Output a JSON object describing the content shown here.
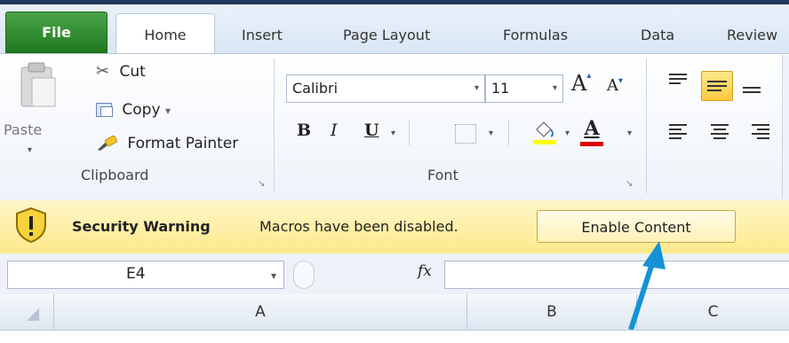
{
  "ribbon_tabs": {
    "file": "File",
    "home": "Home",
    "insert": "Insert",
    "page_layout": "Page Layout",
    "formulas": "Formulas",
    "data": "Data",
    "review": "Review"
  },
  "clipboard": {
    "paste": "Paste",
    "cut": "Cut",
    "copy": "Copy",
    "copy_arrow": "▾",
    "format_painter": "Format Painter",
    "group_label": "Clipboard"
  },
  "font": {
    "font_name": "Calibri",
    "font_size": "11",
    "grow_font": "A",
    "shrink_font": "A",
    "bold": "B",
    "italic": "I",
    "underline": "U",
    "font_color_letter": "A",
    "group_label": "Font",
    "highlight_color": "#ffff00",
    "font_color": "#e00000"
  },
  "security_bar": {
    "title": "Security Warning",
    "message": "Macros have been disabled.",
    "enable_button": "Enable Content"
  },
  "formula_bar": {
    "name_box": "E4",
    "fx_label": "fx",
    "formula_value": ""
  },
  "columns": [
    "A",
    "B",
    "C"
  ],
  "colors": {
    "file_tab": "#2a8a2a",
    "security_bar": "#fde98a",
    "annotation_arrow": "#1592d6",
    "active_align": "#ffd54f"
  }
}
